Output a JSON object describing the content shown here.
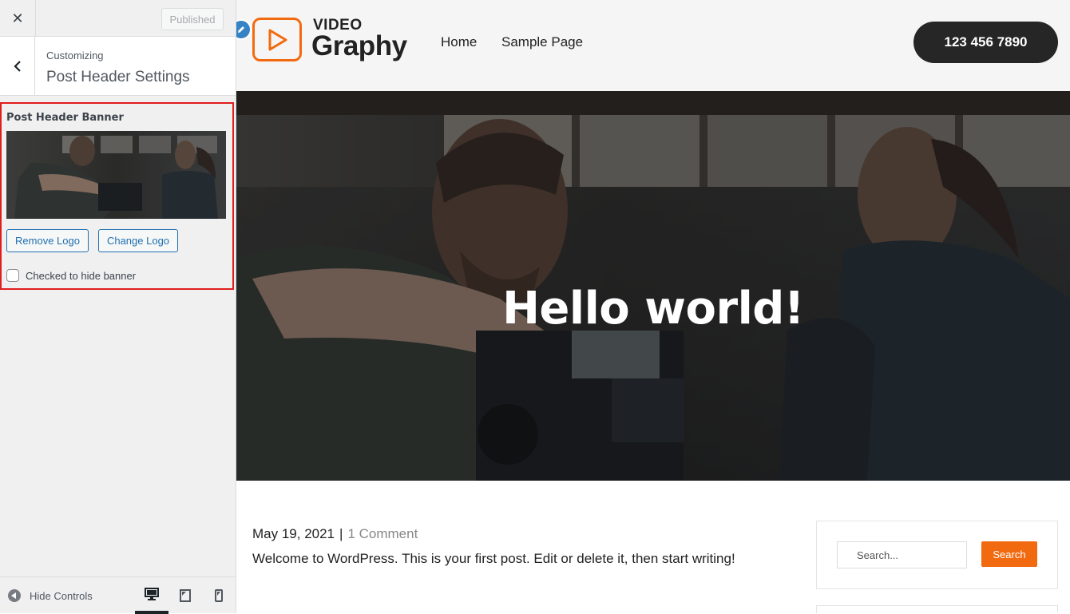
{
  "sidebar": {
    "close_icon": "close-icon",
    "published_label": "Published",
    "customizing_label": "Customizing",
    "section_title": "Post Header Settings",
    "banner_label": "Post Header Banner",
    "remove_logo_label": "Remove Logo",
    "change_logo_label": "Change Logo",
    "hide_banner_label": "Checked to hide banner",
    "hide_banner_checked": false,
    "hide_controls_label": "Hide Controls",
    "devices": [
      "desktop",
      "tablet",
      "mobile"
    ],
    "active_device": "desktop",
    "highlight_color": "#e11d1d"
  },
  "site": {
    "logo_top": "VIDEO",
    "logo_bottom": "Graphy",
    "accent_color": "#f26a10",
    "nav": [
      "Home",
      "Sample Page"
    ],
    "phone": "123 456 7890",
    "hero_title": "Hello world!",
    "post": {
      "date": "May 19, 2021",
      "separator": "|",
      "comments": "1 Comment",
      "excerpt": "Welcome to WordPress. This is your first post. Edit or delete it, then start writing!"
    },
    "search": {
      "placeholder": "Search...",
      "button_label": "Search"
    }
  }
}
